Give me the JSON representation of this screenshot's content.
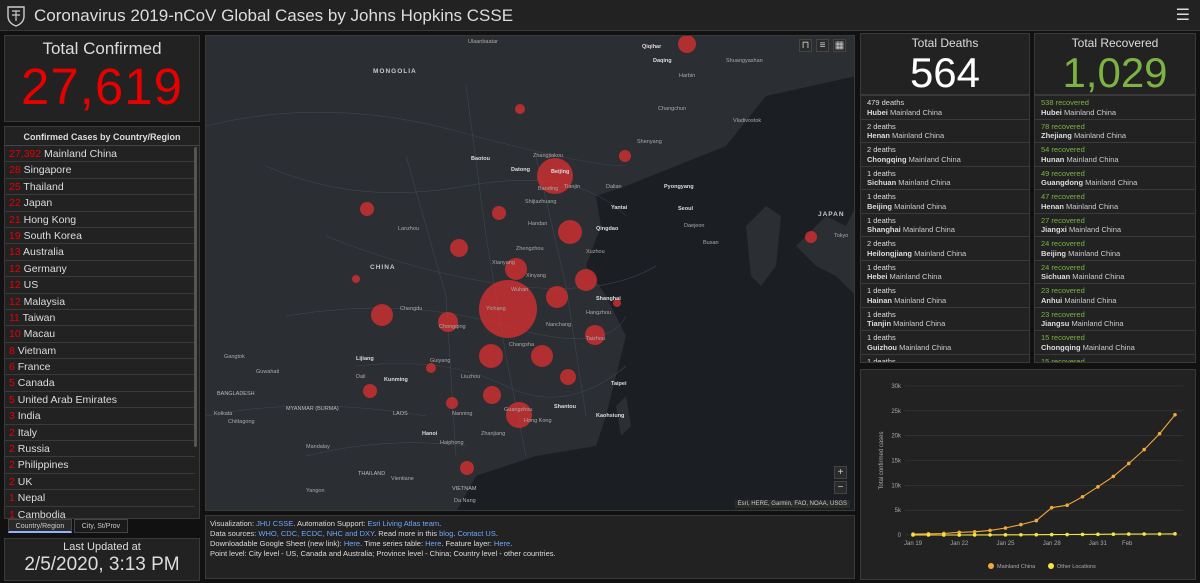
{
  "header": {
    "title": "Coronavirus 2019-nCoV Global Cases by Johns Hopkins CSSE",
    "menu_icon": "hamburger-menu-icon"
  },
  "total_confirmed": {
    "label": "Total Confirmed",
    "value": "27,619"
  },
  "country_list": {
    "header": "Confirmed Cases by Country/Region",
    "items": [
      {
        "count": "27,392",
        "name": "Mainland China"
      },
      {
        "count": "28",
        "name": "Singapore"
      },
      {
        "count": "25",
        "name": "Thailand"
      },
      {
        "count": "22",
        "name": "Japan"
      },
      {
        "count": "21",
        "name": "Hong Kong"
      },
      {
        "count": "19",
        "name": "South Korea"
      },
      {
        "count": "13",
        "name": "Australia"
      },
      {
        "count": "12",
        "name": "Germany"
      },
      {
        "count": "12",
        "name": "US"
      },
      {
        "count": "12",
        "name": "Malaysia"
      },
      {
        "count": "11",
        "name": "Taiwan"
      },
      {
        "count": "10",
        "name": "Macau"
      },
      {
        "count": "8",
        "name": "Vietnam"
      },
      {
        "count": "6",
        "name": "France"
      },
      {
        "count": "5",
        "name": "Canada"
      },
      {
        "count": "5",
        "name": "United Arab Emirates"
      },
      {
        "count": "3",
        "name": "India"
      },
      {
        "count": "2",
        "name": "Italy"
      },
      {
        "count": "2",
        "name": "Russia"
      },
      {
        "count": "2",
        "name": "Philippines"
      },
      {
        "count": "2",
        "name": "UK"
      },
      {
        "count": "1",
        "name": "Nepal"
      },
      {
        "count": "1",
        "name": "Cambodia"
      }
    ]
  },
  "tabs": [
    {
      "label": "Country/Region",
      "active": true
    },
    {
      "label": "City, St/Prov",
      "active": false
    }
  ],
  "last_updated": {
    "label": "Last Updated at",
    "value": "2/5/2020, 3:13 PM"
  },
  "map": {
    "countries": [
      "MONGOLIA",
      "CHINA",
      "JAPAN",
      "MYANMAR (BURMA)",
      "BANGLADESH",
      "LAOS",
      "THAILAND",
      "VIETNAM"
    ],
    "cities": [
      "Ulaanbaatar",
      "Qiqihar",
      "Daqing",
      "Harbin",
      "Changchun",
      "Shuangyashan",
      "Vladivostok",
      "Shenyang",
      "Baotou",
      "Zhangjiakou",
      "Datong",
      "Beijing",
      "Baoding",
      "Tianjin",
      "Dalian",
      "Pyongyang",
      "Seoul",
      "Shijiazhuang",
      "Yantai",
      "Handan",
      "Qingdao",
      "Daejeon",
      "Busan",
      "Lanzhou",
      "Zhengzhou",
      "Xuzhou",
      "Tokyo",
      "Xianyang",
      "Xinyang",
      "Shanghai",
      "Hangzhou",
      "Chengdu",
      "Wuhan",
      "Yichang",
      "Chongqing",
      "Nanchang",
      "Changsha",
      "Taizhou",
      "Guiyang",
      "Kunming",
      "Liuzhou",
      "Lijiang",
      "Dali",
      "Nanning",
      "Guangzhou",
      "Shantou",
      "Taipei",
      "Kaohsiung",
      "Hong Kong",
      "Hanoi",
      "Zhanjiang",
      "Haiphong",
      "Yangon",
      "Chittagong",
      "Mandalay",
      "Da Nang",
      "Vientiane",
      "Guwahati",
      "Kolkata",
      "Gangtok"
    ],
    "attribution": "Esri, HERE, Garmin, FAO, NOAA, USGS",
    "zoom_in": "+",
    "zoom_out": "−"
  },
  "sources": {
    "line1_prefix": "Visualization: ",
    "line1_link1": "JHU CSSE",
    "line1_mid": ". Automation Support: ",
    "line1_link2": "Esri Living Atlas team",
    "line1_end": ".",
    "line2_prefix": "Data sources: ",
    "line2_links": "WHO, CDC, ECDC, NHC and DXY",
    "line2_mid": ". Read more in this ",
    "line2_link_blog": "blog",
    "line2_sep": ". ",
    "line2_link_contact": "Contact US",
    "line2_end": ".",
    "line3_prefix": "Downloadable Google Sheet (new link): ",
    "line3_link1": "Here",
    "line3_mid": ". Time series table: ",
    "line3_link2": "Here",
    "line3_mid2": ". Feature layer: ",
    "line3_link3": "Here",
    "line3_end": ".",
    "line4": "Point level: City level - US, Canada and Australia; Province level - China; Country level - other countries."
  },
  "deaths": {
    "label": "Total Deaths",
    "value": "564",
    "items": [
      {
        "value": "479 deaths",
        "place": "Hubei",
        "region": "Mainland China"
      },
      {
        "value": "2 deaths",
        "place": "Henan",
        "region": "Mainland China"
      },
      {
        "value": "2 deaths",
        "place": "Chongqing",
        "region": "Mainland China"
      },
      {
        "value": "1 deaths",
        "place": "Sichuan",
        "region": "Mainland China"
      },
      {
        "value": "1 deaths",
        "place": "Beijing",
        "region": "Mainland China"
      },
      {
        "value": "1 deaths",
        "place": "Shanghai",
        "region": "Mainland China"
      },
      {
        "value": "2 deaths",
        "place": "Heilongjiang",
        "region": "Mainland China"
      },
      {
        "value": "1 deaths",
        "place": "Hebei",
        "region": "Mainland China"
      },
      {
        "value": "1 deaths",
        "place": "Hainan",
        "region": "Mainland China"
      },
      {
        "value": "1 deaths",
        "place": "Tianjin",
        "region": "Mainland China"
      },
      {
        "value": "1 deaths",
        "place": "Guizhou",
        "region": "Mainland China"
      },
      {
        "value": "1 deaths",
        "place": "",
        "region": ""
      }
    ]
  },
  "recovered": {
    "label": "Total Recovered",
    "value": "1,029",
    "items": [
      {
        "value": "538 recovered",
        "place": "Hubei",
        "region": "Mainland China"
      },
      {
        "value": "78 recovered",
        "place": "Zhejiang",
        "region": "Mainland China"
      },
      {
        "value": "54 recovered",
        "place": "Hunan",
        "region": "Mainland China"
      },
      {
        "value": "49 recovered",
        "place": "Guangdong",
        "region": "Mainland China"
      },
      {
        "value": "47 recovered",
        "place": "Henan",
        "region": "Mainland China"
      },
      {
        "value": "27 recovered",
        "place": "Jiangxi",
        "region": "Mainland China"
      },
      {
        "value": "24 recovered",
        "place": "Beijing",
        "region": "Mainland China"
      },
      {
        "value": "24 recovered",
        "place": "Sichuan",
        "region": "Mainland China"
      },
      {
        "value": "23 recovered",
        "place": "Anhui",
        "region": "Mainland China"
      },
      {
        "value": "23 recovered",
        "place": "Jiangsu",
        "region": "Mainland China"
      },
      {
        "value": "15 recovered",
        "place": "Chongqing",
        "region": "Mainland China"
      },
      {
        "value": "15 recovered",
        "place": "",
        "region": ""
      }
    ]
  },
  "colors": {
    "confirmed_red": "#e60000",
    "recovered_green": "#7cb342",
    "mainland_series": "#f2a93b",
    "other_series": "#f5e642",
    "bubble": "#d32f2f"
  },
  "chart_data": {
    "type": "line",
    "ylabel": "Total confirmed cases",
    "xlabel": "",
    "ylim": [
      0,
      30000
    ],
    "yticks": [
      "0",
      "5k",
      "10k",
      "15k",
      "20k",
      "25k",
      "30k"
    ],
    "xticks": [
      "Jan 19",
      "Jan 22",
      "Jan 25",
      "Jan 28",
      "Jan 31",
      "Feb"
    ],
    "x": [
      "Jan 19",
      "Jan 20",
      "Jan 21",
      "Jan 22",
      "Jan 23",
      "Jan 24",
      "Jan 25",
      "Jan 26",
      "Jan 27",
      "Jan 28",
      "Jan 29",
      "Jan 30",
      "Jan 31",
      "Feb 1",
      "Feb 2",
      "Feb 3",
      "Feb 4",
      "Feb 5"
    ],
    "series": [
      {
        "name": "Mainland China",
        "values": [
          200,
          250,
          310,
          550,
          640,
          920,
          1400,
          2100,
          2900,
          5500,
          6000,
          7700,
          9700,
          11800,
          14400,
          17200,
          20400,
          24200
        ]
      },
      {
        "name": "Other Locations",
        "values": [
          3,
          5,
          8,
          10,
          13,
          20,
          32,
          50,
          60,
          80,
          95,
          120,
          140,
          160,
          180,
          190,
          200,
          230
        ]
      }
    ],
    "legend": "bottom"
  }
}
